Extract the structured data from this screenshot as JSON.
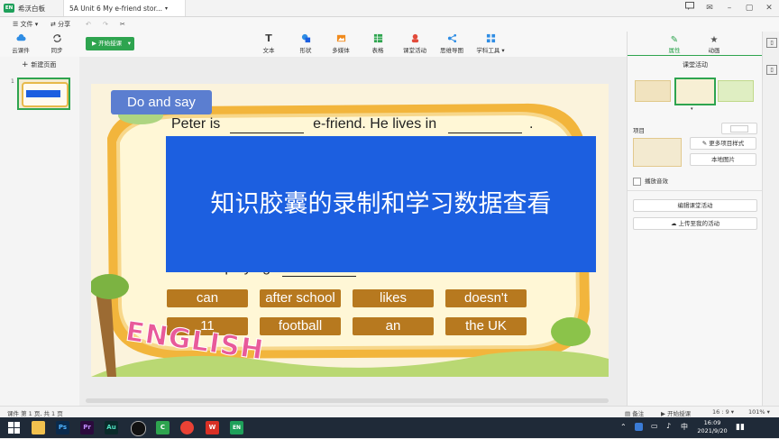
{
  "app": {
    "name": "希沃白板",
    "doc_tab": "5A Unit 6 My e-friend stor...",
    "tab_dropdown": "▾"
  },
  "window": {
    "minimize": "–",
    "maximize": "▢",
    "close": "✕",
    "help": "?",
    "mail": "✉"
  },
  "menu": {
    "file": "文件",
    "share": "分享"
  },
  "toolbar": {
    "cloud": "云课件",
    "sync": "同步",
    "start": "开始授课",
    "items": [
      "文本",
      "形状",
      "多媒体",
      "表格",
      "课堂活动",
      "思维导图",
      "学科工具"
    ]
  },
  "left": {
    "new_page": "新建页面",
    "page_number": "1"
  },
  "slide": {
    "header": "Do and say",
    "sentence1_a": "Peter is",
    "sentence1_b": "e-friend. He lives in",
    "sentence1_end": ".",
    "sentence_partial": "He likes playing",
    "overlay_text": "知识胶囊的录制和学习数据查看",
    "words_row1": [
      "can",
      "after school",
      "likes",
      "doesn't"
    ],
    "words_row2": [
      "11",
      "football",
      "an",
      "the UK"
    ],
    "logo_text": "ENGLISH"
  },
  "right": {
    "tab_properties": "属性",
    "tab_animation": "动画",
    "title": "课堂活动",
    "project_label": "项目",
    "more_styles": "更多项目样式",
    "local_image": "本地图片",
    "play_sound": "播放音效",
    "edit_activity": "编辑课堂活动",
    "upload_activity": "上传至我的活动"
  },
  "status": {
    "page_info": "课件 第 1 页, 共 1 页",
    "notes": "备注",
    "start": "开始授课",
    "ratio": "16 : 9",
    "zoom": "101%"
  },
  "taskbar": {
    "time": "16:09",
    "date": "2021/9/20",
    "ime": "中"
  },
  "colors": {
    "accent_green": "#2ea44f",
    "overlay_blue": "#1c5fe0",
    "header_blue": "#5b7ed0",
    "word_brown": "#b7791f"
  }
}
